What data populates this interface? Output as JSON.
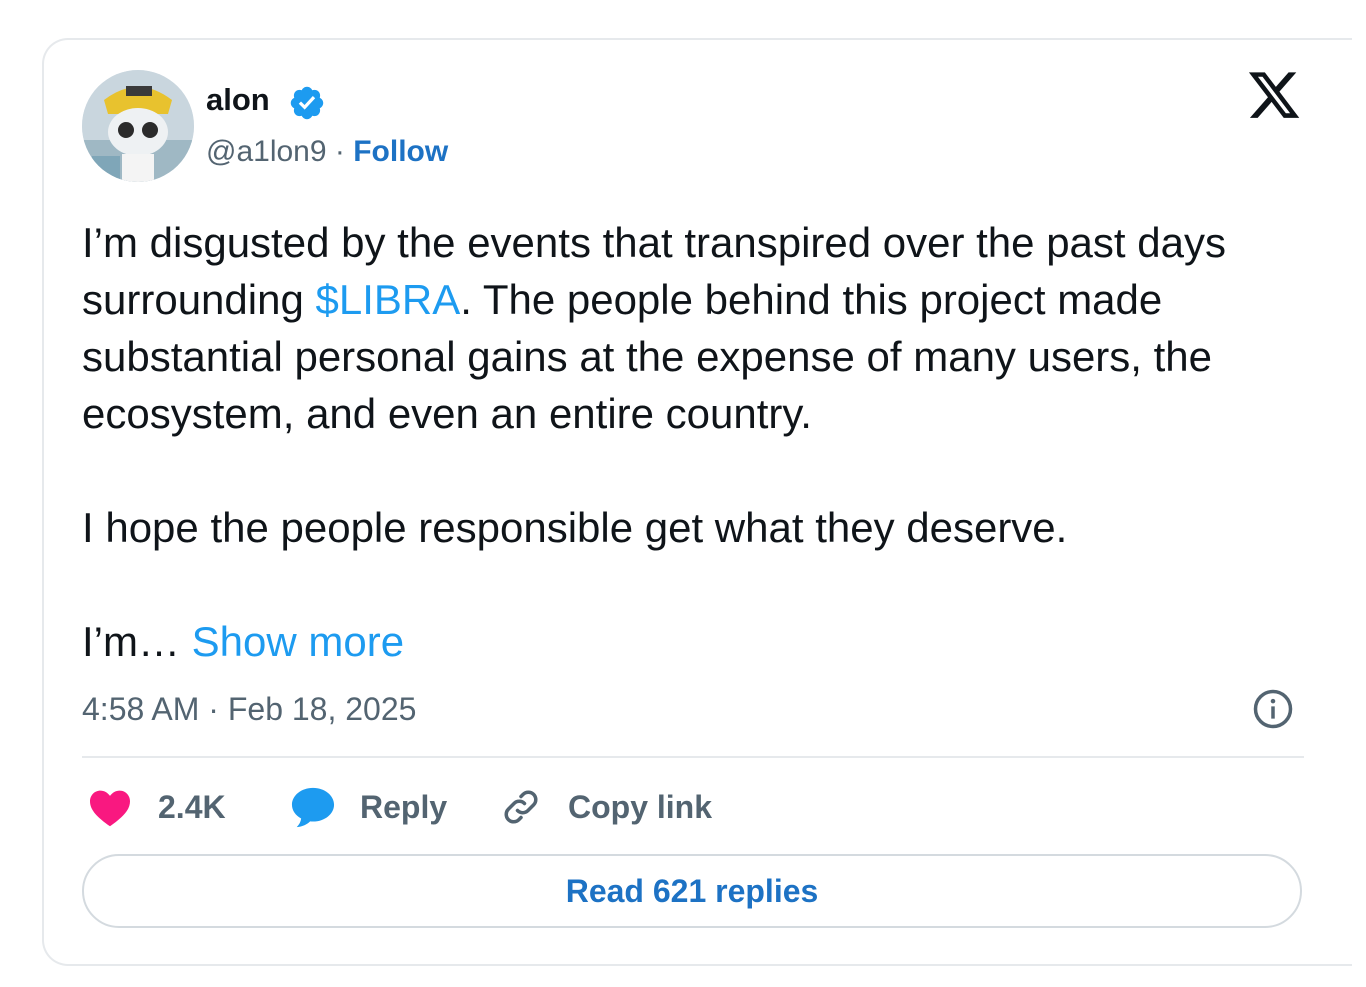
{
  "author": {
    "display_name": "alon",
    "handle": "@a1lon9",
    "separator": "·",
    "follow_label": "Follow",
    "verified": true
  },
  "tweet": {
    "paragraph1_before": "I’m disgusted by the events that transpired over the past days surrounding ",
    "cashtag": "$LIBRA",
    "paragraph1_after": ". The people behind this project made substantial personal gains at the expense of many users, the ecosystem, and even an entire country.",
    "paragraph2": "I hope the people responsible get what they deserve.",
    "truncated_text": "I’m… ",
    "show_more_label": "Show more"
  },
  "meta": {
    "timestamp": "4:58 AM · Feb 18, 2025"
  },
  "actions": {
    "like_count": "2.4K",
    "reply_label": "Reply",
    "copy_link_label": "Copy link"
  },
  "read_replies_label": "Read 621 replies",
  "colors": {
    "accent": "#1d9bf0",
    "link_bold": "#1d72c4",
    "like": "#f91880",
    "muted": "#536471",
    "text": "#0f1419"
  },
  "icons": {
    "platform": "x-logo-icon",
    "verified": "verified-badge-icon",
    "info": "info-icon",
    "like": "heart-icon",
    "reply": "speech-bubble-icon",
    "copy": "link-icon"
  }
}
